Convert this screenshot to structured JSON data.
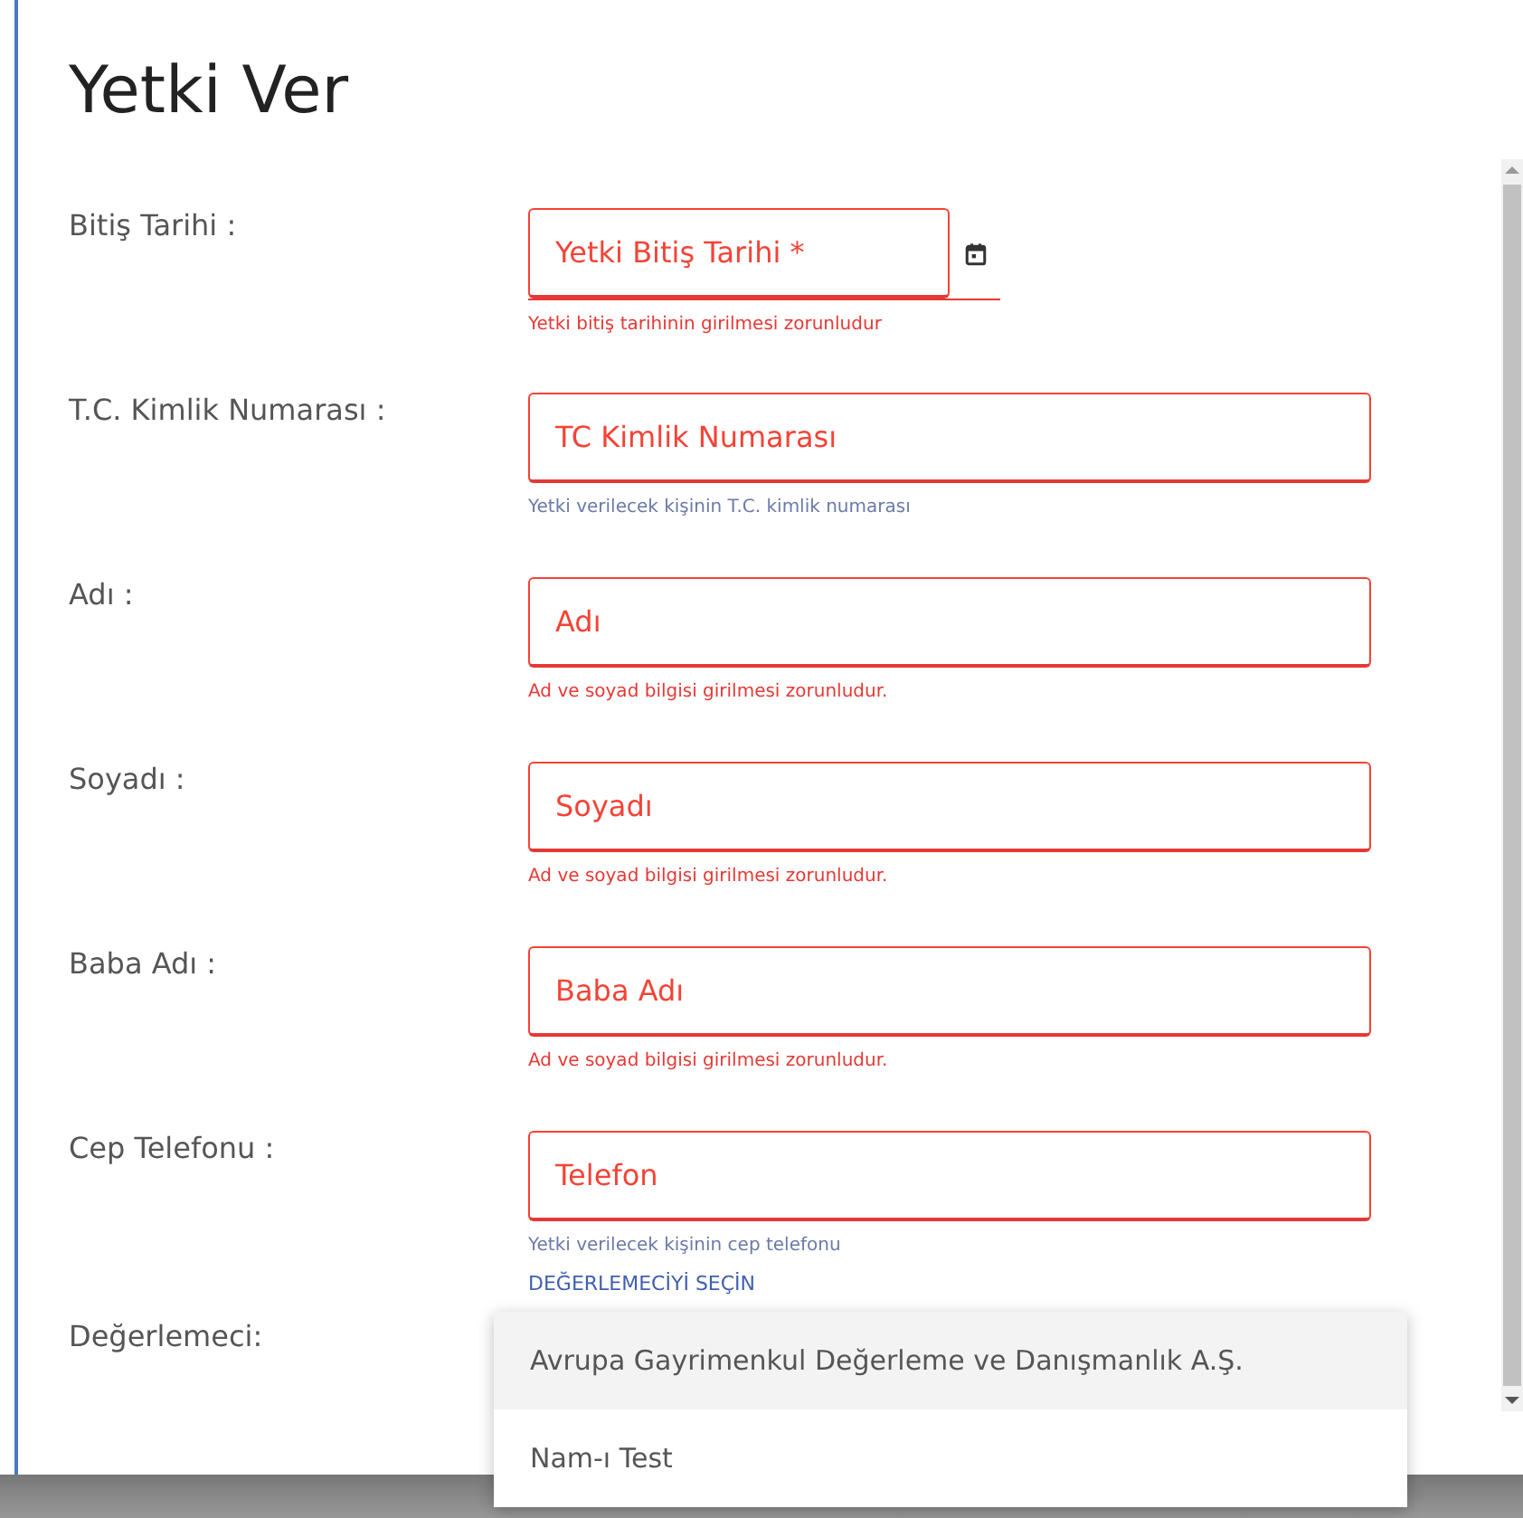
{
  "dialog": {
    "title": "Yetki Ver"
  },
  "fields": [
    {
      "label": "Bitiş Tarihi :",
      "placeholder": "Yetki Bitiş Tarihi *",
      "kind": "date",
      "error": true,
      "helper": {
        "kind": "error",
        "text": "Yetki bitiş tarihinin girilmesi zorunludur"
      }
    },
    {
      "label": "T.C. Kimlik Numarası :",
      "placeholder": "TC Kimlik Numarası",
      "kind": "text",
      "error": true,
      "helper": {
        "kind": "hint",
        "text": "Yetki verilecek kişinin T.C. kimlik numarası"
      }
    },
    {
      "label": "Adı :",
      "placeholder": "Adı",
      "kind": "text",
      "error": true,
      "helper": {
        "kind": "error",
        "text": "Ad ve soyad bilgisi girilmesi zorunludur."
      }
    },
    {
      "label": "Soyadı :",
      "placeholder": "Soyadı",
      "kind": "text",
      "error": true,
      "helper": {
        "kind": "error",
        "text": "Ad ve soyad bilgisi girilmesi zorunludur."
      }
    },
    {
      "label": "Baba Adı :",
      "placeholder": "Baba Adı",
      "kind": "text",
      "error": true,
      "helper": {
        "kind": "error",
        "text": "Ad ve soyad bilgisi girilmesi zorunludur."
      }
    },
    {
      "label": "Cep Telefonu :",
      "placeholder": "Telefon",
      "kind": "text",
      "error": true,
      "helper": {
        "kind": "hint",
        "text": "Yetki verilecek kişinin cep telefonu"
      }
    }
  ],
  "appraiser": {
    "label": "Değerlemeci:",
    "select_button": "DEĞERLEMECİYİ SEÇİN",
    "options": [
      {
        "label": "Avrupa Gayrimenkul Değerleme ve Danışmanlık A.Ş.",
        "selected": true
      },
      {
        "label": "Nam-ı Test",
        "selected": false
      }
    ]
  }
}
